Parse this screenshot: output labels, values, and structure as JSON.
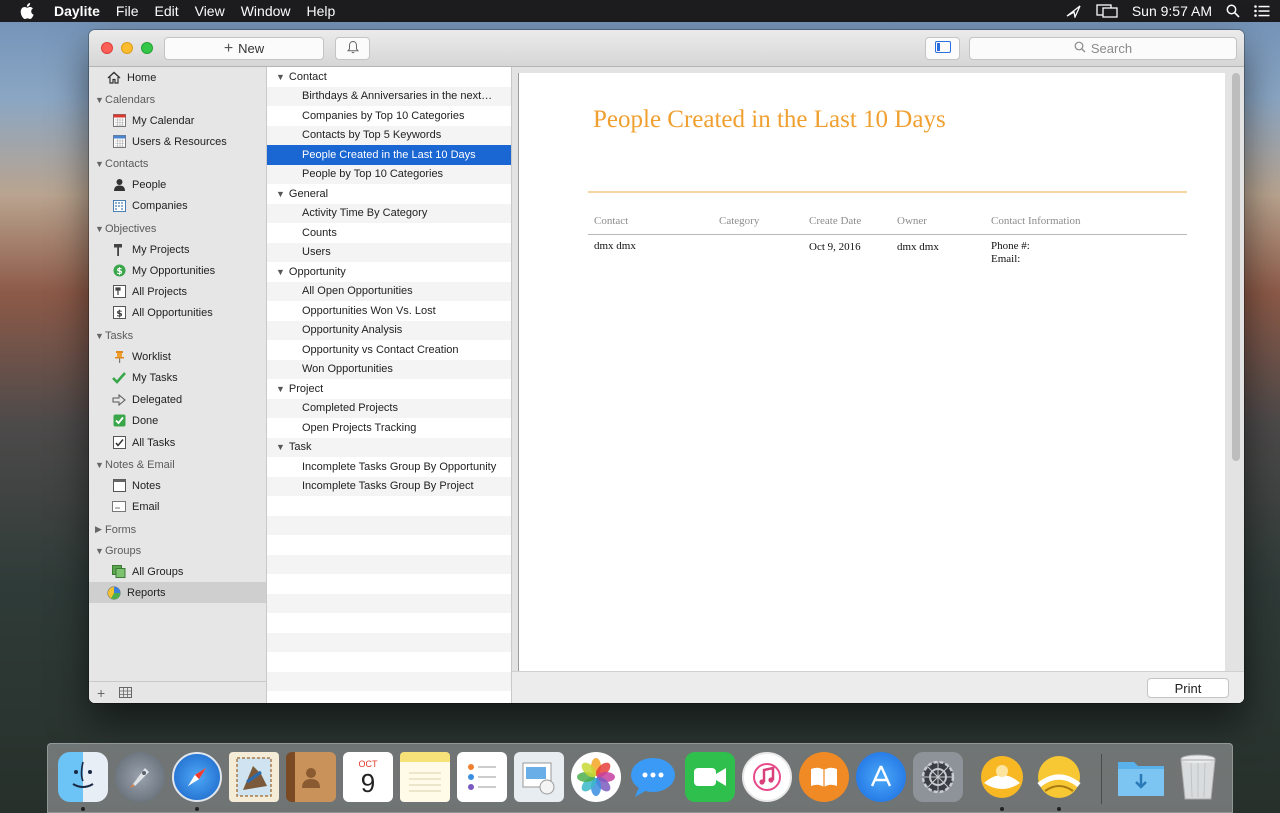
{
  "menubar": {
    "app_name": "Daylite",
    "items": [
      "File",
      "Edit",
      "View",
      "Window",
      "Help"
    ],
    "clock": "Sun 9:57 AM"
  },
  "toolbar": {
    "new_label": "New",
    "search_placeholder": "Search"
  },
  "sidebar": {
    "home": "Home",
    "groups": [
      {
        "label": "Calendars",
        "items": [
          "My Calendar",
          "Users & Resources"
        ]
      },
      {
        "label": "Contacts",
        "items": [
          "People",
          "Companies"
        ]
      },
      {
        "label": "Objectives",
        "items": [
          "My Projects",
          "My Opportunities",
          "All Projects",
          "All Opportunities"
        ]
      },
      {
        "label": "Tasks",
        "items": [
          "Worklist",
          "My Tasks",
          "Delegated",
          "Done",
          "All Tasks"
        ]
      },
      {
        "label": "Notes & Email",
        "items": [
          "Notes",
          "Email"
        ]
      },
      {
        "label": "Forms",
        "items": []
      },
      {
        "label": "Groups",
        "items": [
          "All Groups"
        ]
      }
    ],
    "reports": "Reports"
  },
  "reports": {
    "categories": [
      {
        "label": "Contact",
        "items": [
          "Birthdays & Anniversaries in the next…",
          "Companies by Top 10 Categories",
          "Contacts by Top 5 Keywords",
          "People Created in the Last 10 Days",
          "People by Top 10 Categories"
        ]
      },
      {
        "label": "General",
        "items": [
          "Activity Time By Category",
          "Counts",
          "Users"
        ]
      },
      {
        "label": "Opportunity",
        "items": [
          "All Open Opportunities",
          "Opportunities Won Vs. Lost",
          "Opportunity Analysis",
          "Opportunity vs Contact Creation",
          "Won Opportunities"
        ]
      },
      {
        "label": "Project",
        "items": [
          "Completed Projects",
          "Open Projects Tracking"
        ]
      },
      {
        "label": "Task",
        "items": [
          "Incomplete Tasks Group By Opportunity",
          "Incomplete Tasks Group By Project"
        ]
      }
    ],
    "selected": "People Created in the Last 10 Days"
  },
  "report": {
    "title": "People Created in the Last 10 Days",
    "columns": [
      "Contact",
      "Category",
      "Create Date",
      "Owner",
      "Contact Information"
    ],
    "rows": [
      {
        "contact": "dmx dmx",
        "category": "",
        "create_date": "Oct 9, 2016",
        "owner": "dmx dmx",
        "phone": "Phone #:",
        "email": "Email:"
      }
    ],
    "print_label": "Print"
  },
  "dock": {
    "calendar_month": "OCT",
    "calendar_day": "9"
  },
  "colors": {
    "accent": "#1a66d2",
    "report_title": "#f0a030"
  }
}
